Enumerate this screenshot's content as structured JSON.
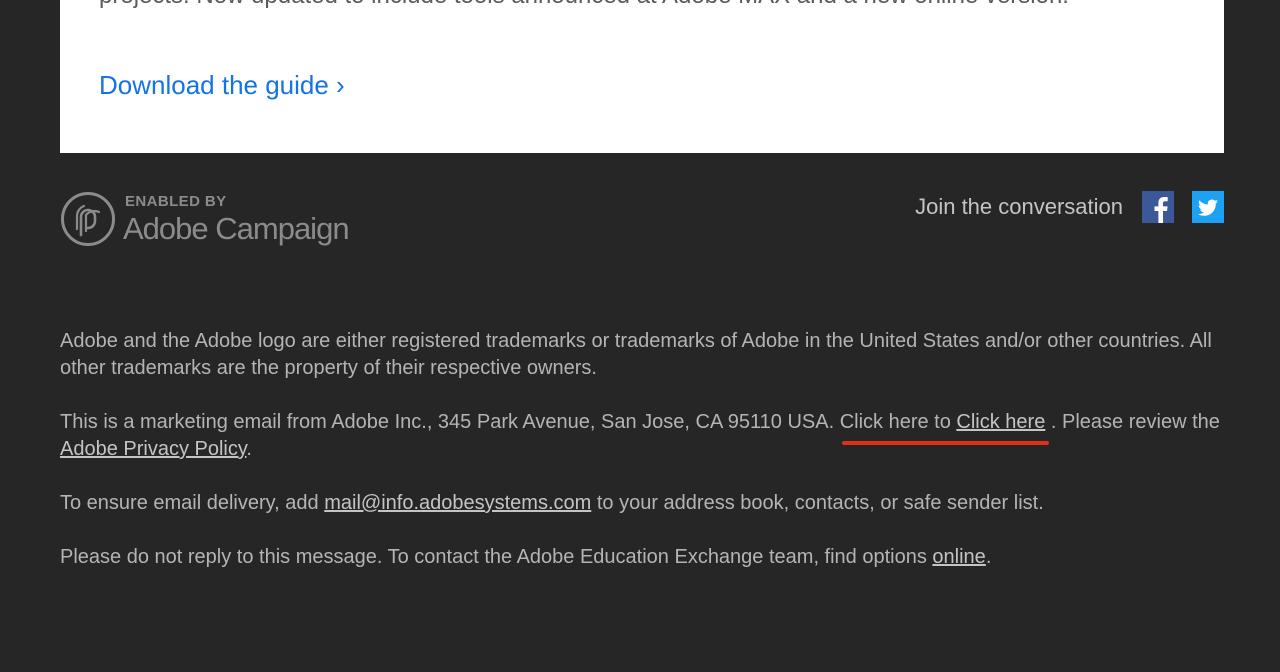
{
  "card": {
    "body_text": "projects. Now updated to include tools announced at Adobe MAX and a new online version.",
    "link_label": "Download the guide ›"
  },
  "brand": {
    "tagline": "ENABLED BY",
    "name": "Adobe Campaign",
    "logo_icon": "adobe-campaign-logo-icon"
  },
  "social": {
    "label": "Join the conversation",
    "facebook_icon": "facebook-icon",
    "twitter_icon": "twitter-icon"
  },
  "legal": {
    "trademark_text": "Adobe and the Adobe logo are either registered trademarks or trademarks of Adobe in the United States and/or other countries. All other trademarks are the property of their respective owners.",
    "marketing_prefix": "This is a marketing email from Adobe Inc., 345 Park Avenue, San Jose, CA 95110 USA.",
    "click_here_to": "Click here to",
    "click_here_link": "Click here",
    "marketing_middle": ". Please review the",
    "privacy_link": "Adobe Privacy Policy",
    "period_1": ".",
    "delivery_prefix": "To ensure email delivery, add",
    "delivery_email": "mail@info.adobesystems.com",
    "delivery_suffix": "to your address book, contacts, or safe sender list.",
    "contact_prefix": "Please do not reply to this message. To contact the Adobe Education Exchange team, find options",
    "contact_link": "online",
    "period_2": "."
  },
  "colors": {
    "background": "#262626",
    "link_blue": "#1473e6",
    "annotation_red": "#e03016",
    "facebook": "#3b5998",
    "twitter": "#1da1f2"
  }
}
